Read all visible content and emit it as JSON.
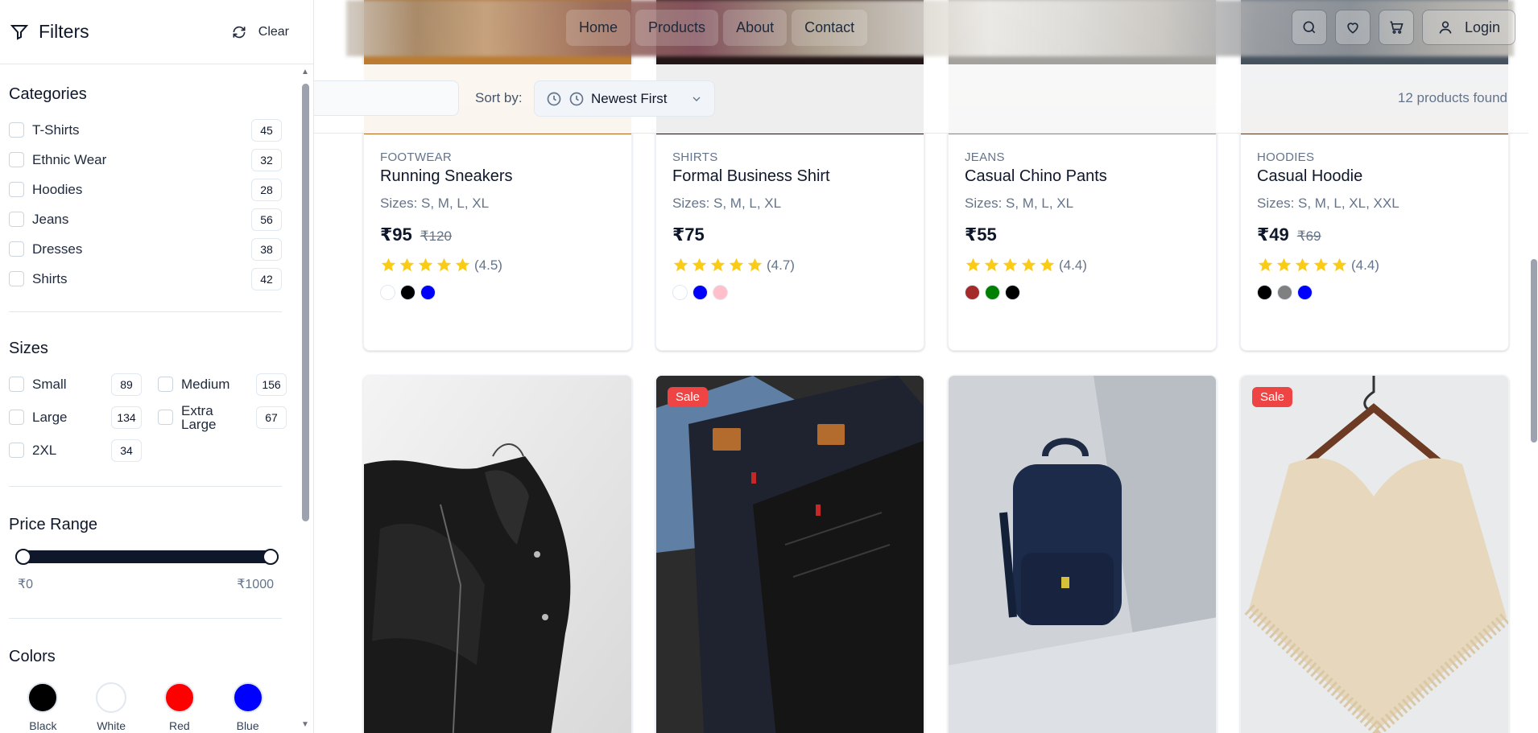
{
  "sidebar": {
    "title": "Filters",
    "clear_label": "Clear",
    "categories": {
      "heading": "Categories",
      "items": [
        {
          "label": "T-Shirts",
          "count": "45"
        },
        {
          "label": "Ethnic Wear",
          "count": "32"
        },
        {
          "label": "Hoodies",
          "count": "28"
        },
        {
          "label": "Jeans",
          "count": "56"
        },
        {
          "label": "Dresses",
          "count": "38"
        },
        {
          "label": "Shirts",
          "count": "42"
        }
      ]
    },
    "sizes": {
      "heading": "Sizes",
      "items": [
        {
          "label": "Small",
          "count": "89"
        },
        {
          "label": "Medium",
          "count": "156"
        },
        {
          "label": "Large",
          "count": "134"
        },
        {
          "label": "Extra Large",
          "count": "67"
        },
        {
          "label": "2XL",
          "count": "34"
        }
      ]
    },
    "price": {
      "heading": "Price Range",
      "min_label": "₹0",
      "max_label": "₹1000"
    },
    "colors": {
      "heading": "Colors",
      "items": [
        {
          "label": "Black",
          "hex": "#000000"
        },
        {
          "label": "White",
          "hex": "#ffffff"
        },
        {
          "label": "Red",
          "hex": "#ff0000"
        },
        {
          "label": "Blue",
          "hex": "#0000ff"
        }
      ]
    }
  },
  "navbar": {
    "links": [
      "Home",
      "Products",
      "About",
      "Contact"
    ],
    "login_label": "Login",
    "icons": [
      "search-icon",
      "heart-icon",
      "cart-icon",
      "user-icon"
    ]
  },
  "toolbar": {
    "sort_label": "Sort by:",
    "sort_value": "Newest First",
    "found_text": "12 products found"
  },
  "products_top": [
    {
      "category": "FOOTWEAR",
      "name": "Running Sneakers",
      "sizes": "Sizes: S, M, L, XL",
      "price": "₹95",
      "old_price": "₹120",
      "rating": "(4.5)",
      "colors": [
        "#ffffff",
        "#000000",
        "#0000ff"
      ]
    },
    {
      "category": "SHIRTS",
      "name": "Formal Business Shirt",
      "sizes": "Sizes: S, M, L, XL",
      "price": "₹75",
      "old_price": "",
      "rating": "(4.7)",
      "colors": [
        "#ffffff",
        "#0000ff",
        "#ffc0cb"
      ]
    },
    {
      "category": "JEANS",
      "name": "Casual Chino Pants",
      "sizes": "Sizes: S, M, L, XL",
      "price": "₹55",
      "old_price": "",
      "rating": "(4.4)",
      "colors": [
        "#a52a2a",
        "#008000",
        "#000000"
      ]
    },
    {
      "category": "HOODIES",
      "name": "Casual Hoodie",
      "sizes": "Sizes: S, M, L, XL, XXL",
      "price": "₹49",
      "old_price": "₹69",
      "rating": "(4.4)",
      "colors": [
        "#000000",
        "#808080",
        "#0000ff"
      ]
    }
  ],
  "products_bottom": [
    {
      "image": "leather-jacket",
      "sale": ""
    },
    {
      "image": "jeans-pile",
      "sale": "Sale"
    },
    {
      "image": "backpack",
      "sale": ""
    },
    {
      "image": "knit-poncho",
      "sale": "Sale"
    }
  ]
}
